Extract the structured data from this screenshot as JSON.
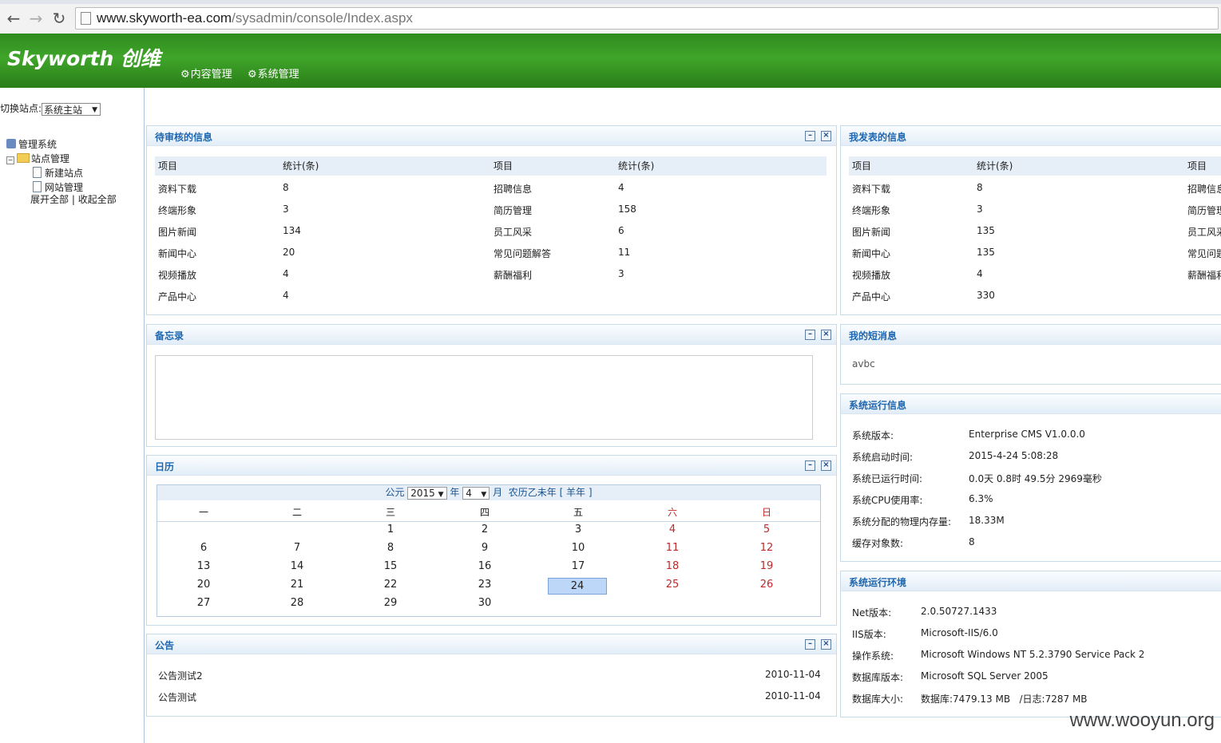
{
  "browser": {
    "url_host": "www.skyworth-ea.com",
    "url_path": "/sysadmin/console/Index.aspx"
  },
  "header": {
    "logo": "Skyworth 创维",
    "menu": [
      "内容管理",
      "系统管理"
    ]
  },
  "sidebar": {
    "switch_label": "切换站点:",
    "site_selected": "系统主站",
    "tree": {
      "root": "管理系统",
      "group": "站点管理",
      "items": [
        "新建站点",
        "网站管理"
      ]
    },
    "expand_all": "展开全部",
    "separator": "|",
    "collapse_all": "收起全部"
  },
  "pending": {
    "title": "待审核的信息",
    "col_item": "项目",
    "col_count": "统计(条)",
    "left": [
      {
        "name": "资料下载",
        "count": "8"
      },
      {
        "name": "终端形象",
        "count": "3"
      },
      {
        "name": "图片新闻",
        "count": "134"
      },
      {
        "name": "新闻中心",
        "count": "20"
      },
      {
        "name": "视频播放",
        "count": "4"
      },
      {
        "name": "产品中心",
        "count": "4"
      }
    ],
    "right": [
      {
        "name": "招聘信息",
        "count": "4"
      },
      {
        "name": "简历管理",
        "count": "158"
      },
      {
        "name": "员工风采",
        "count": "6"
      },
      {
        "name": "常见问题解答",
        "count": "11"
      },
      {
        "name": "薪酬福利",
        "count": "3"
      }
    ]
  },
  "published": {
    "title": "我发表的信息",
    "col_item": "项目",
    "col_count": "统计(条)",
    "left": [
      {
        "name": "资料下载",
        "count": "8"
      },
      {
        "name": "终端形象",
        "count": "3"
      },
      {
        "name": "图片新闻",
        "count": "135"
      },
      {
        "name": "新闻中心",
        "count": "135"
      },
      {
        "name": "视频播放",
        "count": "4"
      },
      {
        "name": "产品中心",
        "count": "330"
      }
    ],
    "right": [
      "招聘信息",
      "简历管理",
      "员工风采",
      "常见问题",
      "薪酬福利"
    ]
  },
  "memo": {
    "title": "备忘录"
  },
  "messages": {
    "title": "我的短消息",
    "items": [
      "avbc"
    ]
  },
  "sysinfo": {
    "title": "系统运行信息",
    "rows": [
      {
        "label": "系统版本:",
        "value": "Enterprise CMS V1.0.0.0"
      },
      {
        "label": "系统启动时间:",
        "value": "2015-4-24 5:08:28"
      },
      {
        "label": "系统已运行时间:",
        "value": "0.0天 0.8时 49.5分 2969毫秒"
      },
      {
        "label": "系统CPU使用率:",
        "value": "6.3%"
      },
      {
        "label": "系统分配的物理内存量:",
        "value": "18.33M"
      },
      {
        "label": "缓存对象数:",
        "value": "8"
      }
    ]
  },
  "sysenv": {
    "title": "系统运行环境",
    "rows": [
      {
        "label": "Net版本:",
        "value": "2.0.50727.1433"
      },
      {
        "label": "IIS版本:",
        "value": "Microsoft-IIS/6.0"
      },
      {
        "label": "操作系统:",
        "value": "Microsoft Windows NT 5.2.3790 Service Pack 2"
      },
      {
        "label": "数据库版本:",
        "value": "Microsoft SQL Server 2005"
      },
      {
        "label": "数据库大小:",
        "value": "数据库:7479.13 MB   /日志:7287 MB"
      }
    ]
  },
  "calendar": {
    "title": "日历",
    "era": "公元",
    "year": "2015",
    "year_unit": "年",
    "month": "4",
    "month_unit": "月",
    "lunar": "农历乙未年 [ 羊年 ]",
    "weekdays": [
      "一",
      "二",
      "三",
      "四",
      "五",
      "六",
      "日"
    ],
    "weeks": [
      [
        "",
        "",
        "1",
        "2",
        "3",
        "4",
        "5"
      ],
      [
        "6",
        "7",
        "8",
        "9",
        "10",
        "11",
        "12"
      ],
      [
        "13",
        "14",
        "15",
        "16",
        "17",
        "18",
        "19"
      ],
      [
        "20",
        "21",
        "22",
        "23",
        "24",
        "25",
        "26"
      ],
      [
        "27",
        "28",
        "29",
        "30",
        "",
        "",
        ""
      ]
    ],
    "today": "24"
  },
  "notice": {
    "title": "公告",
    "items": [
      {
        "text": "公告测试2",
        "date": "2010-11-04"
      },
      {
        "text": "公告测试",
        "date": "2010-11-04"
      }
    ]
  },
  "watermark": "www.wooyun.org",
  "controls": {
    "minimize": "–",
    "close": "×"
  }
}
